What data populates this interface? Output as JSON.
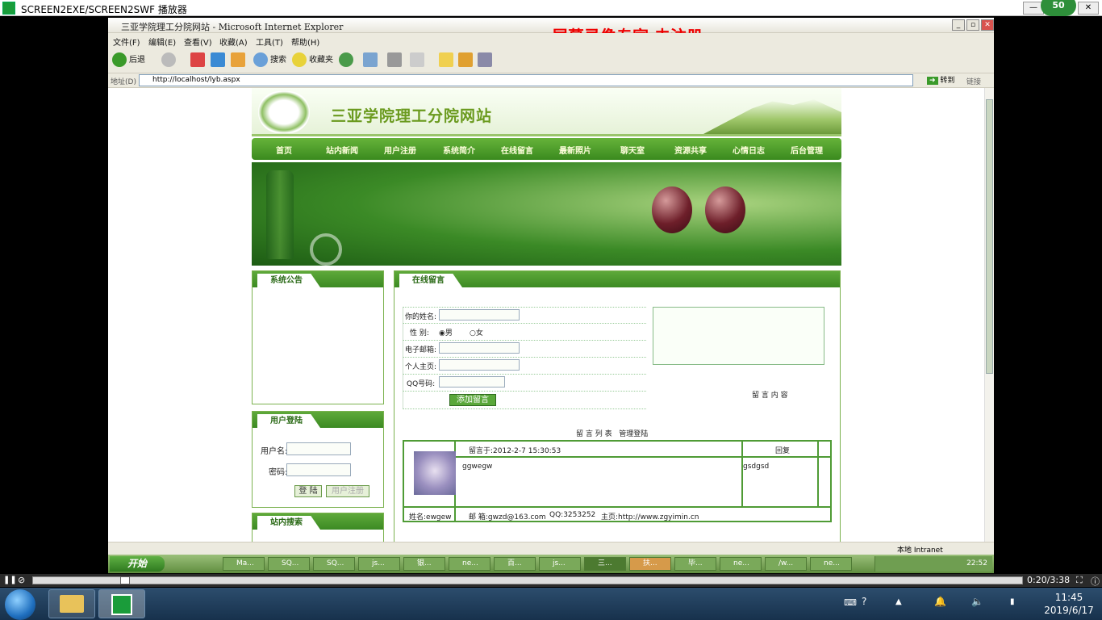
{
  "player": {
    "title": "SCREEN2EXE/SCREEN2SWF 播放器",
    "badge": "50",
    "time": "0:20/3:38",
    "progress": 0.09
  },
  "ie": {
    "title": "三亚学院理工分院网站 - Microsoft Internet Explorer",
    "watermark": "屏幕录像专家 未注册",
    "menu": [
      "文件(F)",
      "编辑(E)",
      "查看(V)",
      "收藏(A)",
      "工具(T)",
      "帮助(H)"
    ],
    "toolbar": {
      "back": "后退",
      "search": "搜索",
      "favorites": "收藏夹"
    },
    "address_label": "地址(D)",
    "address": "http://localhost/lyb.aspx",
    "go": "转到",
    "links": "链接",
    "zone": "本地 Intranet"
  },
  "site": {
    "name": "三亚学院理工分院网站",
    "nav": [
      "首页",
      "站内新闻",
      "用户注册",
      "系统简介",
      "在线留言",
      "最新照片",
      "聊天室",
      "资源共享",
      "心情日志",
      "后台管理"
    ],
    "notice_title": "系统公告",
    "login_title": "用户登陆",
    "username_label": "用户名:",
    "password_label": "密码:",
    "login_button": "登 陆",
    "register_button": "用户注册",
    "search_title": "站内搜索",
    "guestbook_title": "在线留言",
    "form": {
      "name": "你的姓名:",
      "gender": "性 别:",
      "male": "男",
      "female": "女",
      "email": "电子邮箱:",
      "homepage": "个人主页:",
      "qq": "QQ号码:",
      "submit": "添加留言",
      "content_label": "留 言 内 容"
    },
    "list_label": "留 言 列 表",
    "admin_login": "管理登陆",
    "entry": {
      "time": "留言于:2012-2-7 15:30:53",
      "reply_label": "回复",
      "content": "ggwegw",
      "reply": "gsdgsd",
      "name": "姓名:ewgew",
      "email": "邮 箱:gwzd@163.com",
      "qq": "QQ:3253252",
      "homepage": "主页:http://www.zgyimin.cn"
    }
  },
  "xp_taskbar": {
    "start": "开始",
    "tasks": [
      "Ma...",
      "SQ...",
      "SQ...",
      "js...",
      "银...",
      "ne...",
      "百...",
      "js...",
      "三...",
      "扶...",
      "毕...",
      "ne...",
      "/w...",
      "ne..."
    ],
    "clock": "22:52"
  },
  "win7": {
    "time": "11:45",
    "date": "2019/6/17"
  }
}
